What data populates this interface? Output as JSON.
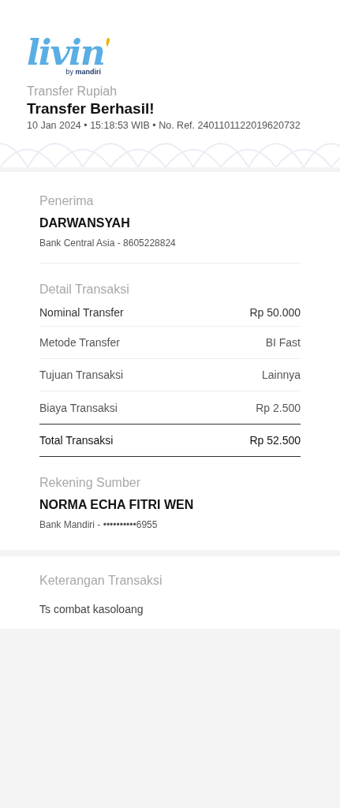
{
  "logo": {
    "wordmark": "livin",
    "byline_prefix": "by",
    "byline_brand": "mandiri"
  },
  "header": {
    "category": "Transfer Rupiah",
    "title": "Transfer Berhasil!",
    "meta": "10 Jan 2024 • 15:18:53 WIB • No. Ref. 2401101122019620732"
  },
  "recipient": {
    "heading": "Penerima",
    "name": "DARWANSYAH",
    "account": "Bank Central Asia - 8605228824"
  },
  "details": {
    "heading": "Detail Transaksi",
    "rows": [
      {
        "kind": "first",
        "label": "Nominal Transfer",
        "value": "Rp 50.000"
      },
      {
        "kind": "normal",
        "label": "Metode Transfer",
        "value": "BI Fast"
      },
      {
        "kind": "normal",
        "label": "Tujuan Transaksi",
        "value": "Lainnya"
      },
      {
        "kind": "normal",
        "label": "Biaya Transaksi",
        "value": "Rp 2.500"
      },
      {
        "kind": "total",
        "label": "Total Transaksi",
        "value": "Rp 52.500"
      }
    ]
  },
  "source": {
    "heading": "Rekening Sumber",
    "name": "NORMA ECHA FITRI WEN",
    "account": "Bank Mandiri - ••••••••••6955"
  },
  "note": {
    "heading": "Keterangan Transaksi",
    "text": "Ts combat kasoloang"
  }
}
